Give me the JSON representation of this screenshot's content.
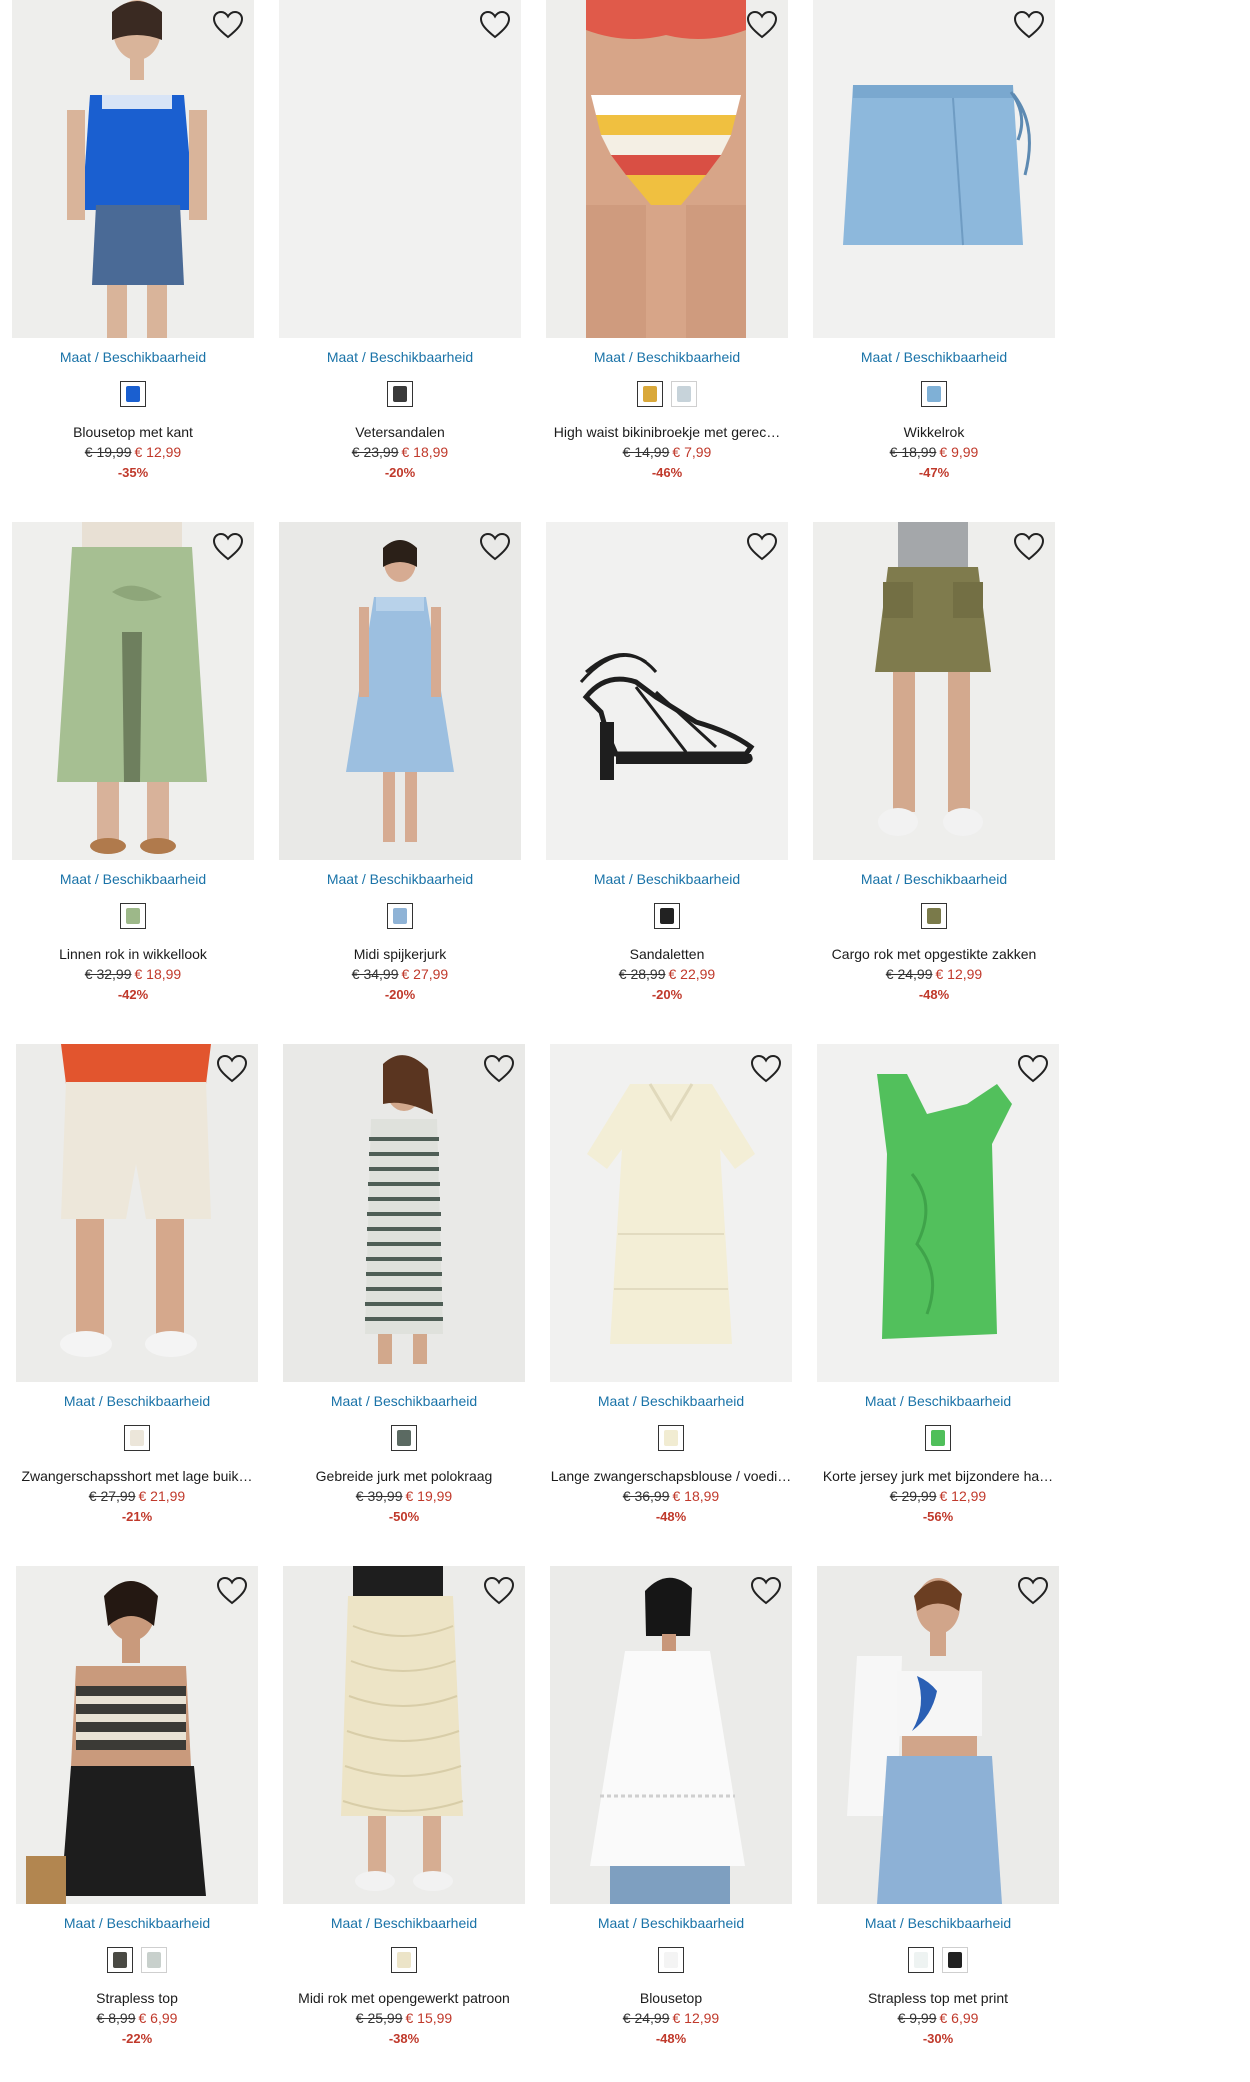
{
  "common": {
    "maat_label": "Maat / Beschikbaarheid"
  },
  "colors": {
    "link": "#1a73a8",
    "sale": "#c0392b"
  },
  "products": [
    {
      "name": "Blousetop met kant",
      "old_price": "€ 19,99",
      "new_price": "€ 12,99",
      "discount": "-35%",
      "swatches": [
        {
          "color": "#1a5fd0",
          "selected": true
        }
      ],
      "art": "blue-top"
    },
    {
      "name": "Vetersandalen",
      "old_price": "€ 23,99",
      "new_price": "€ 18,99",
      "discount": "-20%",
      "swatches": [
        {
          "color": "#3a3a3a",
          "selected": true
        }
      ],
      "art": "empty"
    },
    {
      "name": "High waist bikinibroekje met gerec…",
      "old_price": "€ 14,99",
      "new_price": "€ 7,99",
      "discount": "-46%",
      "swatches": [
        {
          "color": "#d9a83a",
          "selected": true
        },
        {
          "color": "#c7d3da",
          "selected": false
        }
      ],
      "art": "bikini"
    },
    {
      "name": "Wikkelrok",
      "old_price": "€ 18,99",
      "new_price": "€ 9,99",
      "discount": "-47%",
      "swatches": [
        {
          "color": "#7fb0d6",
          "selected": true
        }
      ],
      "art": "skirt-blue"
    },
    {
      "name": "Linnen rok in wikkellook",
      "old_price": "€ 32,99",
      "new_price": "€ 18,99",
      "discount": "-42%",
      "swatches": [
        {
          "color": "#9db889",
          "selected": true
        }
      ],
      "art": "green-skirt"
    },
    {
      "name": "Midi spijkerjurk",
      "old_price": "€ 34,99",
      "new_price": "€ 27,99",
      "discount": "-20%",
      "swatches": [
        {
          "color": "#8fb3d6",
          "selected": true
        }
      ],
      "art": "denim-dress"
    },
    {
      "name": "Sandaletten",
      "old_price": "€ 28,99",
      "new_price": "€ 22,99",
      "discount": "-20%",
      "swatches": [
        {
          "color": "#222222",
          "selected": true
        }
      ],
      "art": "sandal"
    },
    {
      "name": "Cargo rok met opgestikte zakken",
      "old_price": "€ 24,99",
      "new_price": "€ 12,99",
      "discount": "-48%",
      "swatches": [
        {
          "color": "#7a7a4a",
          "selected": true
        }
      ],
      "art": "cargo"
    },
    {
      "name": "Zwangerschapsshort met lage buik…",
      "old_price": "€ 27,99",
      "new_price": "€ 21,99",
      "discount": "-21%",
      "swatches": [
        {
          "color": "#ece6da",
          "selected": true
        }
      ],
      "art": "shorts"
    },
    {
      "name": "Gebreide jurk met polokraag",
      "old_price": "€ 39,99",
      "new_price": "€ 19,99",
      "discount": "-50%",
      "swatches": [
        {
          "color": "#5b6a62",
          "selected": true
        }
      ],
      "art": "knit-dress"
    },
    {
      "name": "Lange zwangerschapsblouse / voedi…",
      "old_price": "€ 36,99",
      "new_price": "€ 18,99",
      "discount": "-48%",
      "swatches": [
        {
          "color": "#f1ecd2",
          "selected": true
        }
      ],
      "art": "blouse-cream"
    },
    {
      "name": "Korte jersey jurk met bijzondere ha…",
      "old_price": "€ 29,99",
      "new_price": "€ 12,99",
      "discount": "-56%",
      "swatches": [
        {
          "color": "#4fbf5a",
          "selected": true
        }
      ],
      "art": "green-dress"
    },
    {
      "name": "Strapless top",
      "old_price": "€ 8,99",
      "new_price": "€ 6,99",
      "discount": "-22%",
      "swatches": [
        {
          "color": "#4a4a44",
          "selected": true
        },
        {
          "color": "#c8d0cc",
          "selected": false
        }
      ],
      "art": "strapless"
    },
    {
      "name": "Midi rok met opengewerkt patroon",
      "old_price": "€ 25,99",
      "new_price": "€ 15,99",
      "discount": "-38%",
      "swatches": [
        {
          "color": "#ece4c8",
          "selected": true
        }
      ],
      "art": "crochet-skirt"
    },
    {
      "name": "Blousetop",
      "old_price": "€ 24,99",
      "new_price": "€ 12,99",
      "discount": "-48%",
      "swatches": [
        {
          "color": "#f4f4f4",
          "selected": true
        }
      ],
      "art": "white-blouse"
    },
    {
      "name": "Strapless top met print",
      "old_price": "€ 9,99",
      "new_price": "€ 6,99",
      "discount": "-30%",
      "swatches": [
        {
          "color": "#eef3f2",
          "selected": true
        },
        {
          "color": "#222222",
          "selected": false
        }
      ],
      "art": "print-top"
    }
  ]
}
